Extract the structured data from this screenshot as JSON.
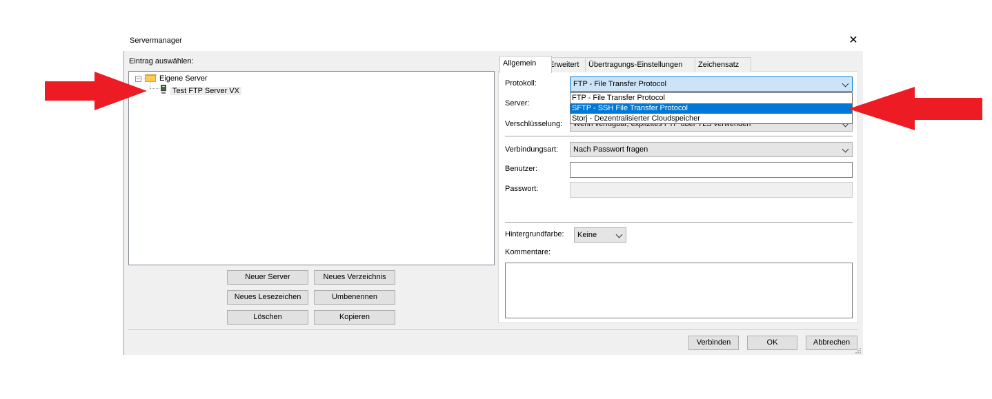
{
  "window": {
    "title": "Servermanager",
    "close_symbol": "✕"
  },
  "left": {
    "select_label": "Eintrag auswählen:",
    "tree": {
      "root": {
        "label": "Eigene Server",
        "expander": "−"
      },
      "child": {
        "label": "Test FTP Server VX"
      }
    },
    "buttons": {
      "new_server": "Neuer Server",
      "new_folder": "Neues Verzeichnis",
      "new_bookmark": "Neues Lesezeichen",
      "rename": "Umbenennen",
      "delete": "Löschen",
      "copy": "Kopieren"
    }
  },
  "tabs": [
    "Allgemein",
    "Erweitert",
    "Übertragungs-Einstellungen",
    "Zeichensatz"
  ],
  "general": {
    "protocol_label": "Protokoll:",
    "protocol_value": "FTP - File Transfer Protocol",
    "protocol_options": [
      "FTP - File Transfer Protocol",
      "SFTP - SSH File Transfer Protocol",
      "Storj - Dezentralisierter Cloudspeicher"
    ],
    "highlighted_option_index": 1,
    "server_label": "Server:",
    "encryption_label": "Verschlüsselung:",
    "encryption_value": "Wenn verfügbar, explizites FTP über TLS verwenden",
    "connection_label": "Verbindungsart:",
    "connection_value": "Nach Passwort fragen",
    "user_label": "Benutzer:",
    "user_value": "",
    "password_label": "Passwort:",
    "bgcolor_label": "Hintergrundfarbe:",
    "bgcolor_value": "Keine",
    "comments_label": "Kommentare:",
    "comments_value": ""
  },
  "footer": {
    "connect": "Verbinden",
    "ok": "OK",
    "cancel": "Abbrechen"
  },
  "colors": {
    "annotation_arrow": "#ed1c24",
    "selection": "#0078d7"
  }
}
